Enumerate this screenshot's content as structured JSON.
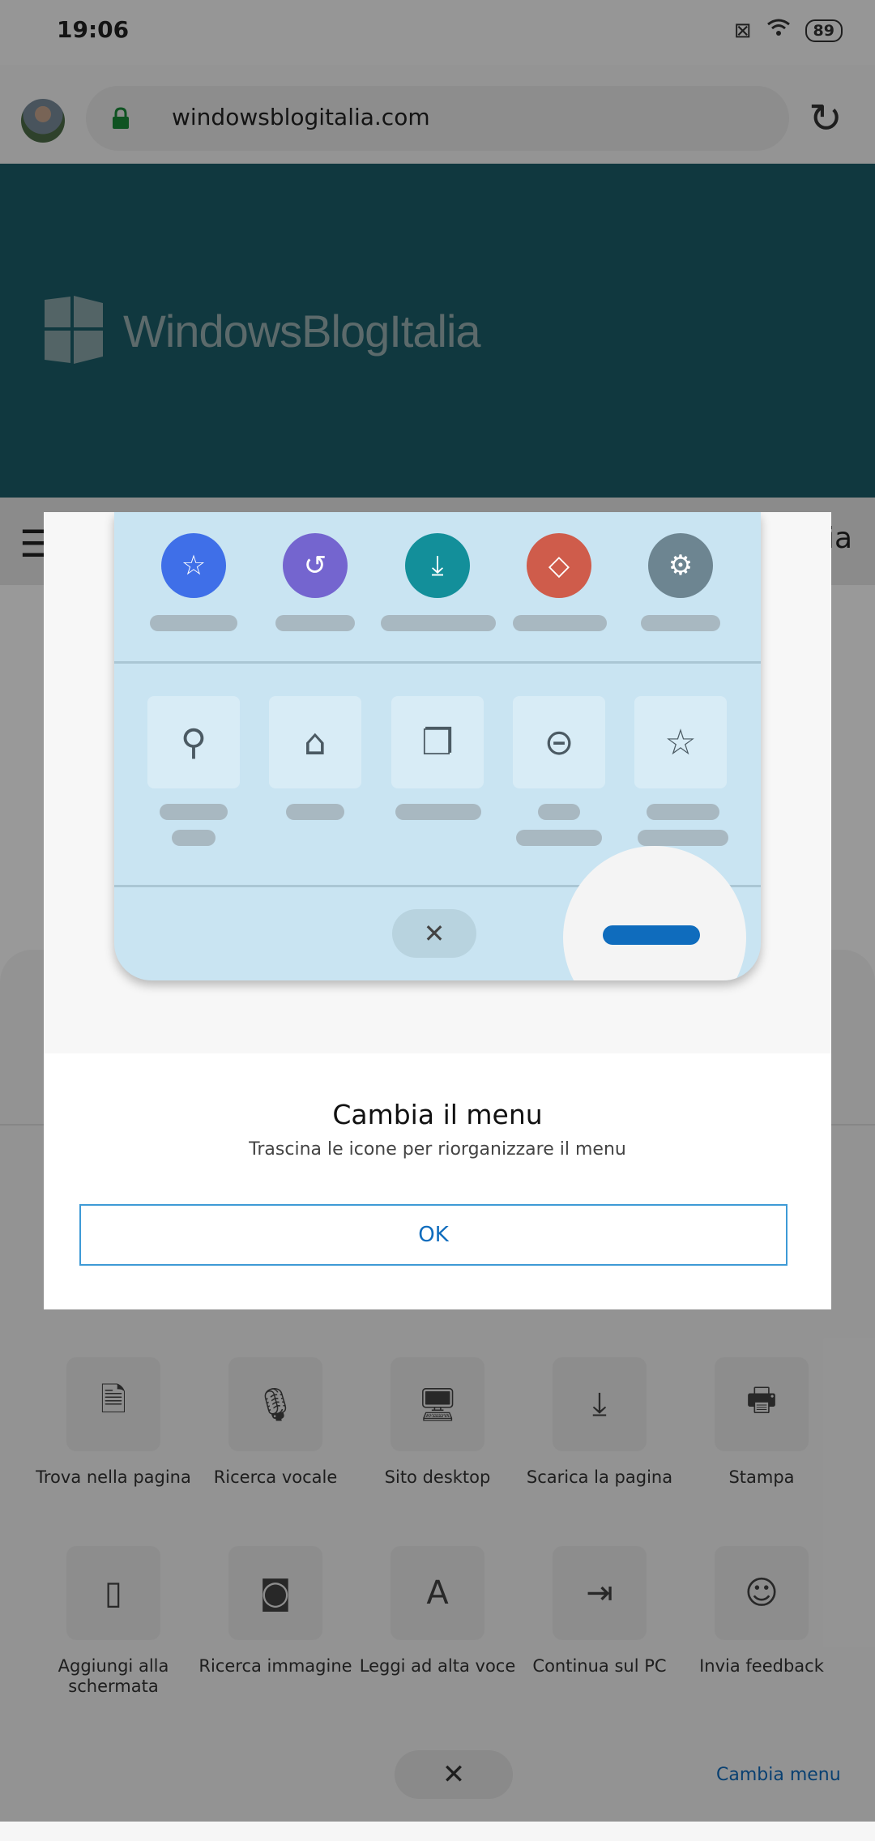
{
  "status_bar": {
    "time": "19:06",
    "battery": "89"
  },
  "address_bar": {
    "url": "windowsblogitalia.com"
  },
  "site": {
    "title": "WindowsBlogItalia",
    "nav_partial": "ia"
  },
  "menu": {
    "items": [
      {
        "label": "Trova nella pagina",
        "icon": "find-in-page-icon",
        "glyph": "🗎"
      },
      {
        "label": "Ricerca vocale",
        "icon": "microphone-icon",
        "glyph": "🎙"
      },
      {
        "label": "Sito desktop",
        "icon": "desktop-icon",
        "glyph": "🖥"
      },
      {
        "label": "Scarica la pagina",
        "icon": "download-icon",
        "glyph": "⤓"
      },
      {
        "label": "Stampa",
        "icon": "printer-icon",
        "glyph": "🖶"
      },
      {
        "label": "Aggiungi alla schermata",
        "icon": "phone-icon",
        "glyph": "▯"
      },
      {
        "label": "Ricerca immagine",
        "icon": "camera-icon",
        "glyph": "◙"
      },
      {
        "label": "Leggi ad alta voce",
        "icon": "read-aloud-icon",
        "glyph": "A"
      },
      {
        "label": "Continua sul PC",
        "icon": "continue-on-pc-icon",
        "glyph": "⇥"
      },
      {
        "label": "Invia feedback",
        "icon": "feedback-icon",
        "glyph": "☺"
      }
    ],
    "change_menu_label": "Cambia menu"
  },
  "dialog": {
    "title": "Cambia il menu",
    "subtitle": "Trascina le icone per riorganizzare il menu",
    "ok_label": "OK",
    "illustration": {
      "circle_icons": [
        {
          "icon": "star-icon",
          "glyph": "☆",
          "color": "#3f6fe8"
        },
        {
          "icon": "history-icon",
          "glyph": "↺",
          "color": "#7465cf"
        },
        {
          "icon": "download-icon",
          "glyph": "⤓",
          "color": "#138f9a"
        },
        {
          "icon": "tag-icon",
          "glyph": "◇",
          "color": "#cf5c4b"
        },
        {
          "icon": "settings-icon",
          "glyph": "⚙",
          "color": "#6d8591"
        }
      ],
      "tile_icons": [
        {
          "icon": "search-icon",
          "glyph": "⚲"
        },
        {
          "icon": "home-icon",
          "glyph": "⌂"
        },
        {
          "icon": "tabs-icon",
          "glyph": "❐"
        },
        {
          "icon": "vr-headset-icon",
          "glyph": "⊝"
        },
        {
          "icon": "add-favorite-icon",
          "glyph": "☆"
        }
      ]
    }
  }
}
